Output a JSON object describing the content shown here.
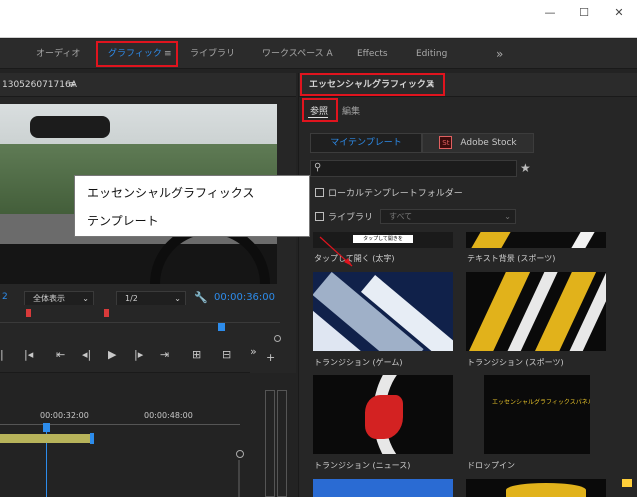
{
  "window": {
    "minimize": "—",
    "maximize": "☐",
    "close": "✕"
  },
  "workspace_tabs": [
    {
      "label": "オーディオ",
      "active": false
    },
    {
      "label": "グラフィック",
      "active": true
    },
    {
      "label": "ライブラリ",
      "active": false
    },
    {
      "label": "ワークスペース A",
      "active": false
    },
    {
      "label": "Effects",
      "active": false
    },
    {
      "label": "Editing",
      "active": false
    }
  ],
  "tab_menu": "≡",
  "more": "»",
  "program": {
    "sequence_name": "130526071716A",
    "menu": "≡",
    "left_num": "2",
    "zoom": "全体表示",
    "resolution": "1/2",
    "timecode": "00:00:36:00",
    "wrench": "🔧"
  },
  "timeline": {
    "tick1": "00:00:32:00",
    "tick2": "00:00:48:00"
  },
  "eg": {
    "title": "エッセンシャルグラフィックス",
    "menu": "≡",
    "tab_browse": "参照",
    "tab_edit": "編集",
    "my_templates": "マイテンプレート",
    "adobe_stock": "Adobe Stock",
    "stock_badge": "St",
    "local_folder": "ローカルテンプレートフォルダー",
    "library": "ライブラリ",
    "library_select": "すべて",
    "items": [
      "タップして開く (太字)",
      "テキスト背景 (スポーツ)",
      "トランジション (ゲーム)",
      "トランジション (スポーツ)",
      "トランジション (ニュース)",
      "ドロップイン"
    ],
    "item1_text": "タップして開く (太字)",
    "dropin_text": "エッセンシャルグラフィックスパネル",
    "tap_thumb_text": "タップして開きを"
  },
  "callout": {
    "line1": "エッセンシャルグラフィックス",
    "line2": "テンプレート"
  },
  "colors": {
    "accent": "#2d8ceb",
    "highlight": "#e0141e"
  }
}
